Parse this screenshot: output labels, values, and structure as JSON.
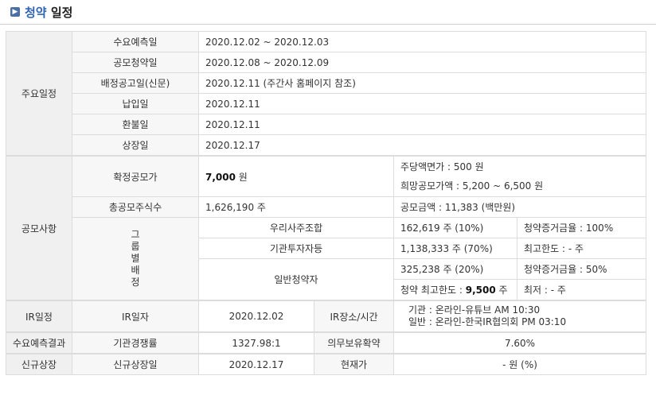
{
  "header": {
    "title_accent": "청약",
    "title_rest": " 일정"
  },
  "main_schedule": {
    "section": "주요일정",
    "rows": [
      {
        "label": "수요예측일",
        "value": "2020.12.02  ~  2020.12.03"
      },
      {
        "label": "공모청약일",
        "value": "2020.12.08  ~  2020.12.09"
      },
      {
        "label": "배정공고일(신문)",
        "value": "2020.12.11 (주간사 홈페이지 참조)"
      },
      {
        "label": "납입일",
        "value": "2020.12.11"
      },
      {
        "label": "환불일",
        "value": "2020.12.11"
      },
      {
        "label": "상장일",
        "value": "2020.12.17"
      }
    ]
  },
  "offering": {
    "section": "공모사항",
    "confirmed_price_label": "확정공모가",
    "confirmed_price_value": "7,000",
    "confirmed_price_unit": " 원",
    "par_value": "주당액면가 :  500 원",
    "desired_range": "희망공모가액 :   5,200 ~ 6,500 원",
    "total_shares_label": "총공모주식수",
    "total_shares_value": "1,626,190 주",
    "amount": "공모금액 :  11,383 (백만원)",
    "group_label": "그\n룹\n별\n배\n정",
    "groups": [
      {
        "name": "우리사주조합",
        "shares": "162,619 주  (10%)",
        "extra": "청약증거금율 : 100%"
      },
      {
        "name": "기관투자자등",
        "shares": "1,138,333 주  (70%)",
        "extra": "최고한도 :  - 주"
      },
      {
        "name": "일반청약자",
        "shares": "325,238 주  (20%)",
        "extra": "청약증거금율 : 50%"
      }
    ],
    "max_limit_label": "청약 최고한도 :  ",
    "max_limit_value": "9,500",
    "max_limit_unit": " 주",
    "min_label": "최저 :  - 주"
  },
  "ir": {
    "section": "IR일정",
    "date_label": "IR일자",
    "date_value": "2020.12.02",
    "place_label": "IR장소/시간",
    "place_line1": "기관 : 온라인-유튜브 AM 10:30",
    "place_line2": "일반 : 온라인-한국IR협의회 PM 03:10"
  },
  "demand": {
    "section": "수요예측결과",
    "competition_label": "기관경쟁률",
    "competition_value": "1327.98:1",
    "lockup_label": "의무보유확약",
    "lockup_value": "7.60%"
  },
  "listing": {
    "section": "신규상장",
    "date_label": "신규상장일",
    "date_value": "2020.12.17",
    "price_label": "현재가",
    "price_value": "- 원 (%)"
  }
}
